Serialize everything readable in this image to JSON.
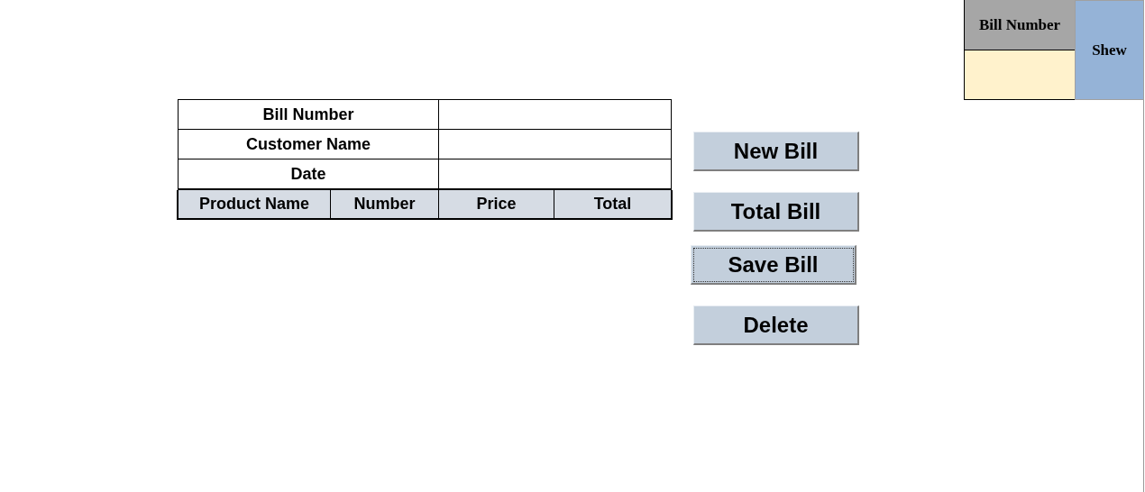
{
  "bill_form": {
    "fields": [
      {
        "label": "Bill Number"
      },
      {
        "label": "Customer Name"
      },
      {
        "label": "Date"
      }
    ],
    "columns": [
      "Product Name",
      "Number",
      "Price",
      "Total"
    ]
  },
  "buttons": [
    {
      "label": "New Bill",
      "focused": false
    },
    {
      "label": "Total Bill",
      "focused": false
    },
    {
      "label": "Save Bill",
      "focused": true
    },
    {
      "label": "Delete",
      "focused": false
    }
  ],
  "lookup": {
    "label": "Bill Number",
    "button": "Shew"
  }
}
